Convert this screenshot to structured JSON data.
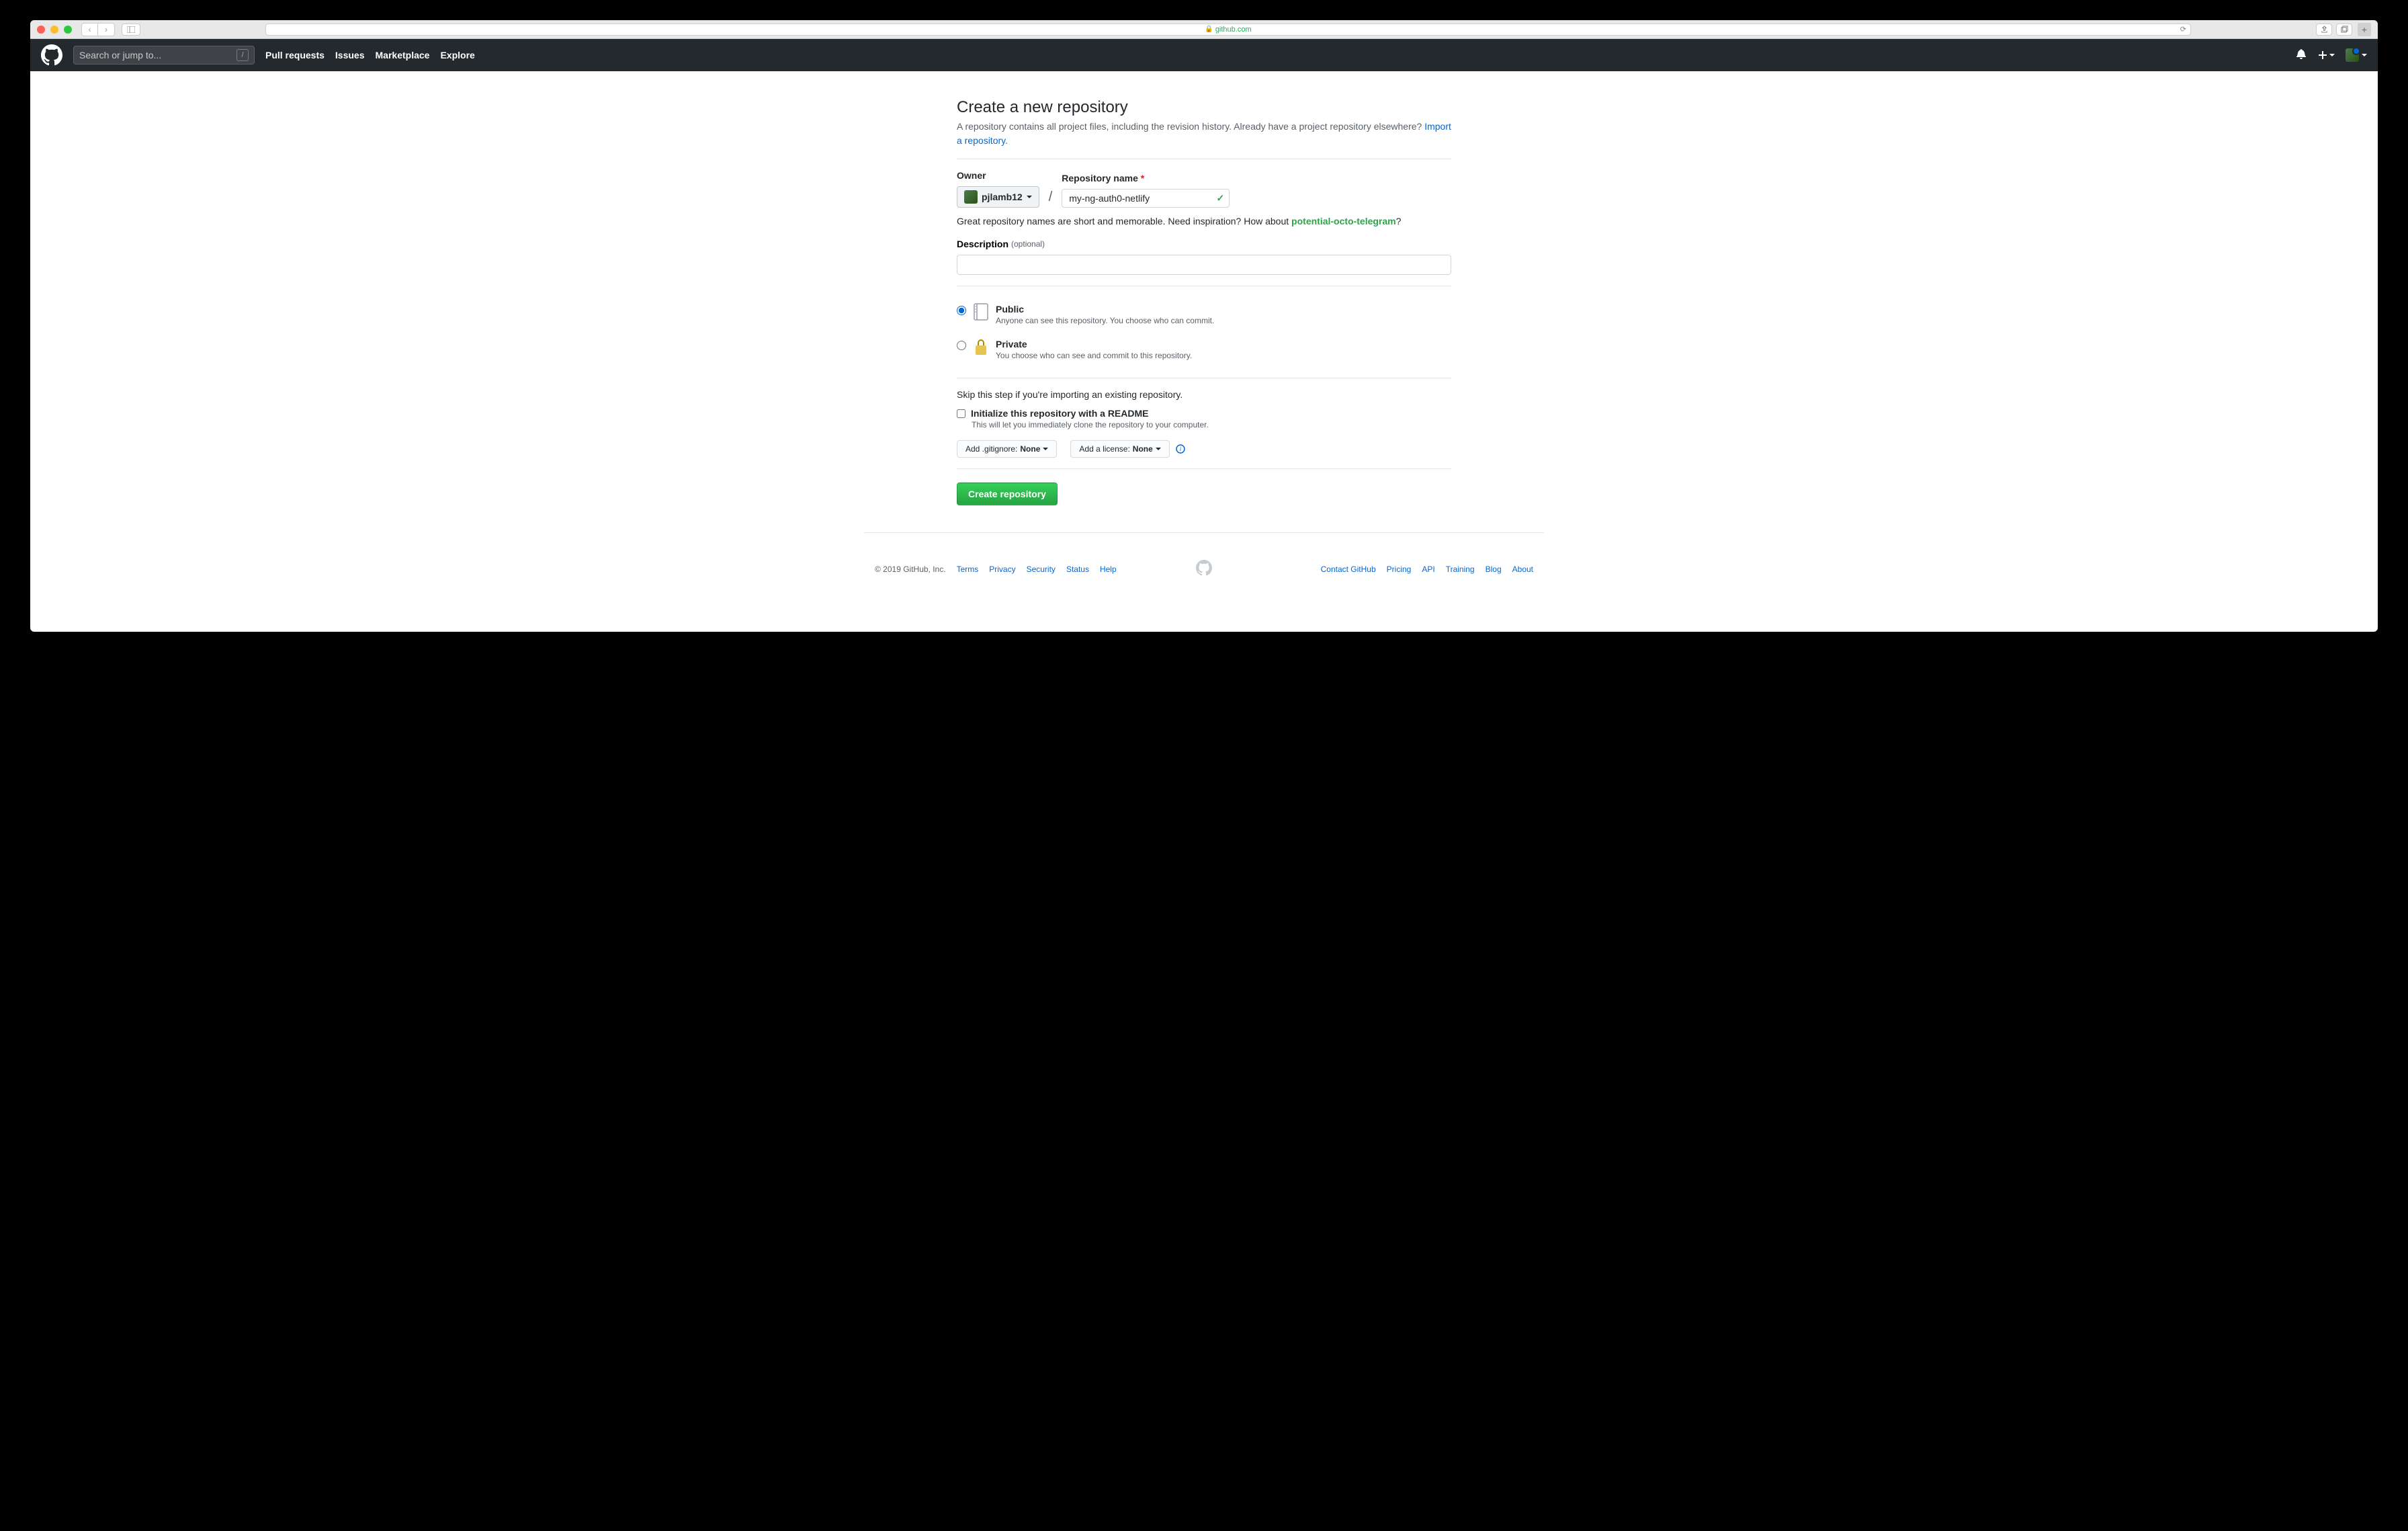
{
  "browser": {
    "url_domain": "github.com"
  },
  "header": {
    "search_placeholder": "Search or jump to...",
    "nav": {
      "pull_requests": "Pull requests",
      "issues": "Issues",
      "marketplace": "Marketplace",
      "explore": "Explore"
    }
  },
  "page": {
    "title": "Create a new repository",
    "description_pre": "A repository contains all project files, including the revision history. Already have a project repository elsewhere? ",
    "import_link": "Import a repository."
  },
  "form": {
    "owner_label": "Owner",
    "owner_value": "pjlamb12",
    "repo_label": "Repository name",
    "repo_value": "my-ng-auth0-netlify",
    "hint_text": "Great repository names are short and memorable. Need inspiration? How about ",
    "hint_suggestion": "potential-octo-telegram",
    "hint_suffix": "?",
    "desc_label": "Description",
    "desc_optional": "(optional)",
    "visibility": {
      "public_title": "Public",
      "public_sub": "Anyone can see this repository. You choose who can commit.",
      "private_title": "Private",
      "private_sub": "You choose who can see and commit to this repository."
    },
    "skip_note": "Skip this step if you're importing an existing repository.",
    "readme_title": "Initialize this repository with a README",
    "readme_sub": "This will let you immediately clone the repository to your computer.",
    "gitignore_prefix": "Add .gitignore: ",
    "gitignore_value": "None",
    "license_prefix": "Add a license: ",
    "license_value": "None",
    "submit": "Create repository"
  },
  "footer": {
    "copyright": "© 2019 GitHub, Inc.",
    "left": {
      "terms": "Terms",
      "privacy": "Privacy",
      "security": "Security",
      "status": "Status",
      "help": "Help"
    },
    "right": {
      "contact": "Contact GitHub",
      "pricing": "Pricing",
      "api": "API",
      "training": "Training",
      "blog": "Blog",
      "about": "About"
    }
  }
}
